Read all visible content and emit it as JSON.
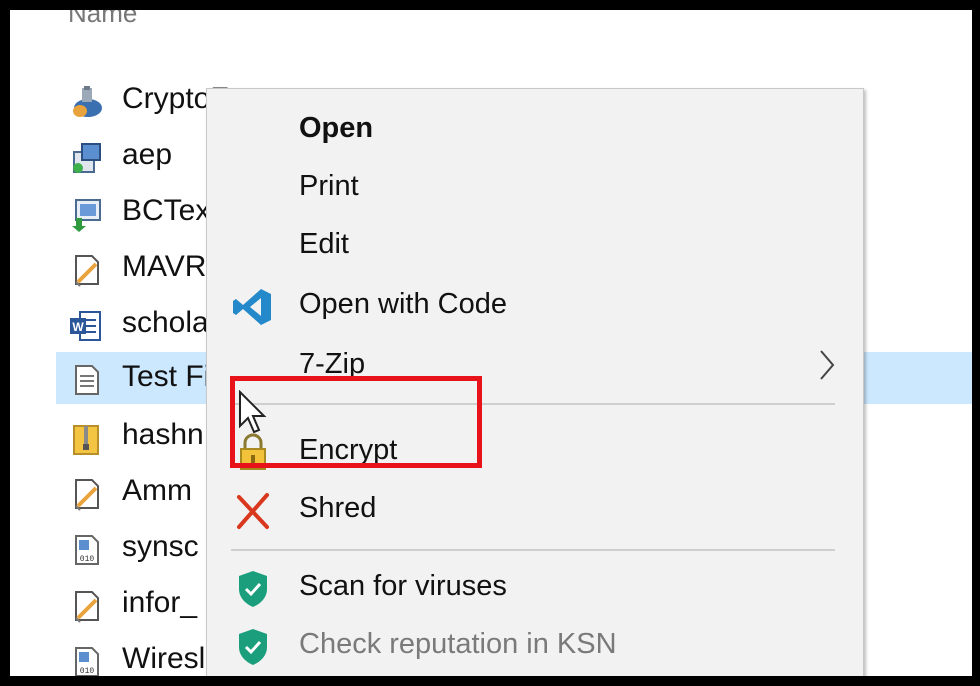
{
  "file_list": {
    "column_header": "Name",
    "files": [
      {
        "name": "CryptoForge",
        "icon": "cryptoforge-app-icon",
        "selected": false
      },
      {
        "name": "aep",
        "icon": "installer-icon",
        "selected": false
      },
      {
        "name": "BCTex",
        "icon": "install-download-icon",
        "selected": false
      },
      {
        "name": "MAVR",
        "icon": "script-document-icon",
        "selected": false
      },
      {
        "name": "schola",
        "icon": "word-document-icon",
        "selected": false
      },
      {
        "name": "Test Fi",
        "icon": "text-document-icon",
        "selected": true
      },
      {
        "name": "hashn",
        "icon": "zip-folder-icon",
        "selected": false
      },
      {
        "name": "Amm",
        "icon": "script-document-icon",
        "selected": false
      },
      {
        "name": "synsc",
        "icon": "binary-file-icon",
        "selected": false
      },
      {
        "name": "infor_",
        "icon": "script-document-icon",
        "selected": false
      },
      {
        "name": "Wiresl",
        "icon": "binary-file-icon",
        "selected": false
      }
    ]
  },
  "context_menu": {
    "items": [
      {
        "label": "Open",
        "bold": true
      },
      {
        "label": "Print"
      },
      {
        "label": "Edit"
      },
      {
        "label": "Open with Code",
        "icon": "vscode-icon"
      },
      {
        "label": "7-Zip",
        "has_submenu": true
      },
      {
        "label": "Encrypt",
        "icon": "lock-icon",
        "highlighted": true
      },
      {
        "label": "Shred",
        "icon": "red-x-icon"
      },
      {
        "label": "Scan for viruses",
        "icon": "kaspersky-shield-icon"
      },
      {
        "label": "Check reputation in KSN",
        "icon": "kaspersky-shield-icon",
        "disabled": true
      }
    ]
  },
  "colors": {
    "selection": "#cce8ff",
    "highlight_box": "#e8121b",
    "vscode_blue": "#2489ca",
    "kaspersky_green": "#1a9e7b",
    "shred_red": "#d9381e"
  }
}
